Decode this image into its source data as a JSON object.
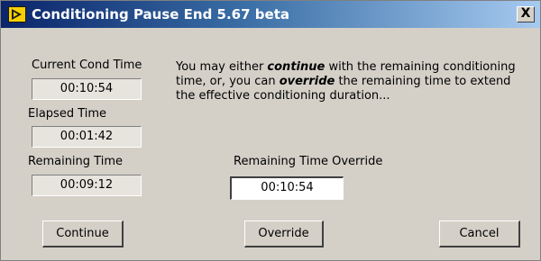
{
  "window": {
    "title": "Conditioning Pause End  5.67 beta",
    "app_icon": "labview-run-arrow-icon",
    "close_label": "X"
  },
  "fields": {
    "current_cond_time": {
      "label": "Current Cond Time",
      "value": "00:10:54"
    },
    "elapsed_time": {
      "label": "Elapsed Time",
      "value": "00:01:42"
    },
    "remaining_time": {
      "label": "Remaining Time",
      "value": "00:09:12"
    },
    "remaining_time_override": {
      "label": "Remaining Time Override",
      "value": "00:10:54"
    }
  },
  "message": {
    "part1": "You may either ",
    "emphasis1": "continue",
    "part2": " with the remaining conditioning time, or, you can ",
    "emphasis2": "override",
    "part3": " the remaining time to extend the effective conditioning duration..."
  },
  "buttons": {
    "continue": "Continue",
    "override": "Override",
    "cancel": "Cancel"
  },
  "colors": {
    "title_bar_start": "#0a246a",
    "title_bar_end": "#a6caf0",
    "dialog_background": "#d4d0c8"
  }
}
